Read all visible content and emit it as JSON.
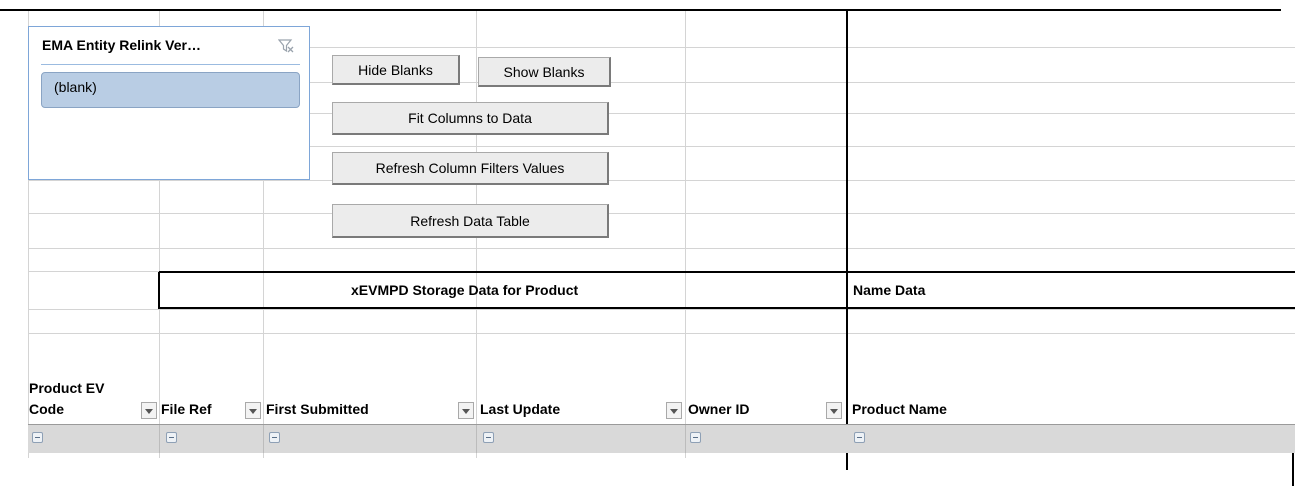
{
  "slicer": {
    "title": "EMA Entity Relink Ver…",
    "clear_filter_icon": "clear-filter-icon",
    "items": [
      "(blank)"
    ]
  },
  "buttons": {
    "hide_blanks": "Hide Blanks",
    "show_blanks": "Show Blanks",
    "fit_columns": "Fit Columns to Data",
    "refresh_filters": "Refresh Column Filters Values",
    "refresh_table": "Refresh Data Table"
  },
  "section_headers": {
    "storage": "xEVMPD Storage Data for Product",
    "name_data": "Name Data"
  },
  "columns": [
    {
      "label_line1": "Product EV",
      "label_line2": "Code"
    },
    {
      "label": "File Ref"
    },
    {
      "label": "First Submitted"
    },
    {
      "label": "Last Update"
    },
    {
      "label": "Owner ID"
    },
    {
      "label": "Product Name"
    }
  ],
  "colors": {
    "slicer_border": "#7ea6d8",
    "slicer_item": "#b9cde4",
    "subtotal_row": "#d9d9d9",
    "button_face": "#ececec"
  }
}
